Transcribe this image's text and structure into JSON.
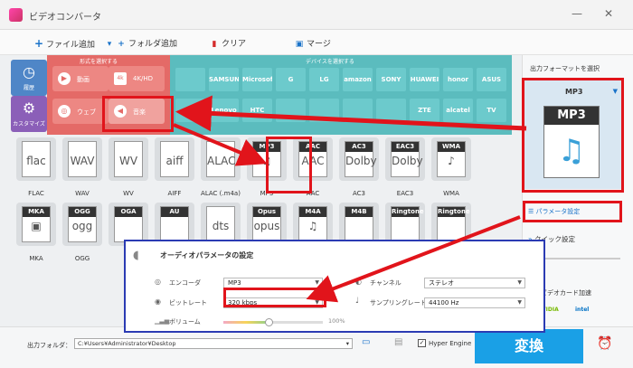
{
  "window": {
    "title": "ビデオコンバータ"
  },
  "toolbar": {
    "add_file": "ファイル追加",
    "add_folder": "フォルダ追加",
    "clear": "クリア",
    "merge": "マージ"
  },
  "sidebar": {
    "history": "履歴",
    "customize": "カスタマイズ"
  },
  "format_panel": {
    "header": "形式を選択する",
    "items": [
      {
        "label": "動画",
        "icon": "play-icon"
      },
      {
        "label": "4K/HD",
        "icon": "4k-icon"
      },
      {
        "label": "ウェブ",
        "icon": "web-icon"
      },
      {
        "label": "音楽",
        "icon": "music-icon"
      }
    ]
  },
  "device_panel": {
    "header": "デバイスを選択する",
    "row1": [
      "",
      "SAMSUNG",
      "Microsoft",
      "G",
      "LG",
      "amazon",
      "SONY",
      "HUAWEI",
      "honor",
      "ASUS"
    ],
    "row2": [
      "",
      "Lenovo",
      "HTC",
      "",
      "",
      "",
      "",
      "ZTE",
      "alcatel",
      "TV"
    ]
  },
  "formats_row1": [
    {
      "tag": "",
      "glyph": "flac",
      "label": "FLAC"
    },
    {
      "tag": "",
      "glyph": "WAV",
      "label": "WAV"
    },
    {
      "tag": "",
      "glyph": "WV",
      "label": "WV"
    },
    {
      "tag": "",
      "glyph": "aiff",
      "label": "AIFF"
    },
    {
      "tag": "",
      "glyph": "ALAC",
      "label": "ALAC (.m4a)"
    },
    {
      "tag": "MP3",
      "glyph": "♫",
      "label": "MP3"
    },
    {
      "tag": "AAC",
      "glyph": "AAC",
      "label": "AAC"
    },
    {
      "tag": "AC3",
      "glyph": "Dolby",
      "label": "AC3"
    },
    {
      "tag": "EAC3",
      "glyph": "Dolby",
      "label": "EAC3"
    },
    {
      "tag": "WMA",
      "glyph": "♪",
      "label": "WMA"
    }
  ],
  "formats_row2": [
    {
      "tag": "MKA",
      "glyph": "▣",
      "label": "MKA"
    },
    {
      "tag": "OGG",
      "glyph": "ogg",
      "label": "OGG"
    },
    {
      "tag": "OGA",
      "glyph": "",
      "label": ""
    },
    {
      "tag": "AU",
      "glyph": "",
      "label": ""
    },
    {
      "tag": "",
      "glyph": "dts",
      "label": ""
    },
    {
      "tag": "Opus",
      "glyph": "opus",
      "label": ""
    },
    {
      "tag": "M4A",
      "glyph": "♫",
      "label": ""
    },
    {
      "tag": "M4B",
      "glyph": "",
      "label": ""
    },
    {
      "tag": "Ringtone",
      "glyph": "",
      "label": ""
    },
    {
      "tag": "Ringtone",
      "glyph": "",
      "label": ""
    }
  ],
  "output_format": {
    "heading": "出力フォーマットを選択",
    "selected": "MP3",
    "tile": "MP3"
  },
  "right_panel": {
    "param_settings": "パラメータ設定",
    "quick_settings": "クイック設定",
    "gpu_accel": "ビデオカード加速",
    "nvidia": "NVIDIA",
    "intel": "intel"
  },
  "dialog": {
    "title": "オーディオパラメータの設定",
    "encoder_label": "エンコーダ",
    "encoder_value": "MP3",
    "channel_label": "チャンネル",
    "channel_value": "ステレオ",
    "bitrate_label": "ビットレート",
    "bitrate_value": "320 kbps",
    "samplerate_label": "サンプリングレート",
    "samplerate_value": "44100 Hz",
    "volume_label": "ボリューム",
    "volume_value": "100%",
    "volume_level": 0.45
  },
  "bottom": {
    "output_folder_label": "出力フォルダ：",
    "output_path": "C:¥Users¥Administrator¥Desktop",
    "hyper_engine": "Hyper Engine",
    "convert": "変換"
  },
  "colors": {
    "convert_blue": "#1aa0e6",
    "highlight_red": "#e1141b",
    "category_red": "#e46a67",
    "device_teal": "#5bbcbe",
    "dialog_border": "#2b3bb3"
  }
}
